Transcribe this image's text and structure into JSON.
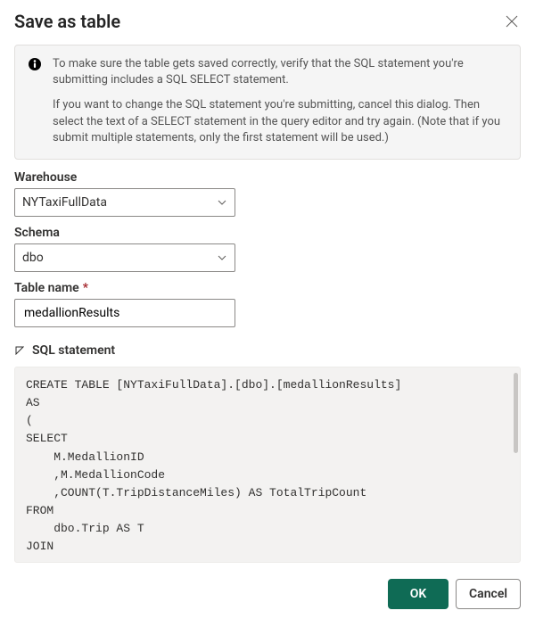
{
  "dialog": {
    "title": "Save as table"
  },
  "info": {
    "paragraph1": "To make sure the table gets saved correctly, verify that the SQL statement you're submitting includes a SQL SELECT statement.",
    "paragraph2": "If you want to change the SQL statement you're submitting, cancel this dialog. Then select the text of a SELECT statement in the query editor and try again. (Note that if you submit multiple statements, only the first statement will be used.)"
  },
  "fields": {
    "warehouse": {
      "label": "Warehouse",
      "value": "NYTaxiFullData"
    },
    "schema": {
      "label": "Schema",
      "value": "dbo"
    },
    "tableName": {
      "label": "Table name",
      "value": "medallionResults",
      "required": "*"
    }
  },
  "sqlSection": {
    "label": "SQL statement",
    "code": "CREATE TABLE [NYTaxiFullData].[dbo].[medallionResults]\nAS\n(\nSELECT\n    M.MedallionID\n    ,M.MedallionCode\n    ,COUNT(T.TripDistanceMiles) AS TotalTripCount\nFROM\n    dbo.Trip AS T\nJOIN"
  },
  "footer": {
    "ok": "OK",
    "cancel": "Cancel"
  }
}
